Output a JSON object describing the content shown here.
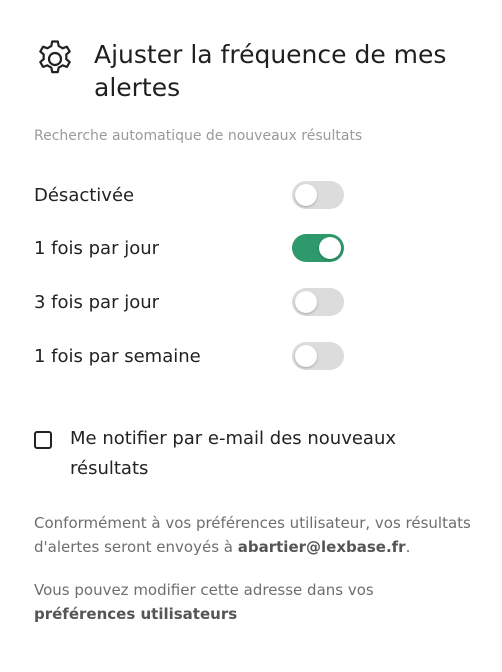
{
  "header": {
    "title": "Ajuster la fréquence de mes alertes",
    "icon": "gear-icon"
  },
  "subtitle": "Recherche automatique de nouveaux résultats",
  "frequency_options": [
    {
      "label": "Désactivée",
      "enabled": false
    },
    {
      "label": "1 fois par jour",
      "enabled": true
    },
    {
      "label": "3 fois par jour",
      "enabled": false
    },
    {
      "label": "1 fois par semaine",
      "enabled": false
    }
  ],
  "email_notification": {
    "label": "Me notifier par e-mail des nouveaux résultats",
    "checked": false
  },
  "info": {
    "line1_prefix": "Conformément à vos préférences utilisateur, vos résultats d'alertes seront envoyés à ",
    "email": "abartier@lexbase.fr",
    "line1_suffix": ".",
    "line2_prefix": "Vous pouvez modifier cette adresse dans vos ",
    "preferences_link": "préférences utilisateurs"
  },
  "colors": {
    "toggle_on": "#2e9a6c",
    "toggle_off": "#dcdcdc",
    "subtitle": "#9a9a9a",
    "info_text": "#6e6e6e"
  }
}
